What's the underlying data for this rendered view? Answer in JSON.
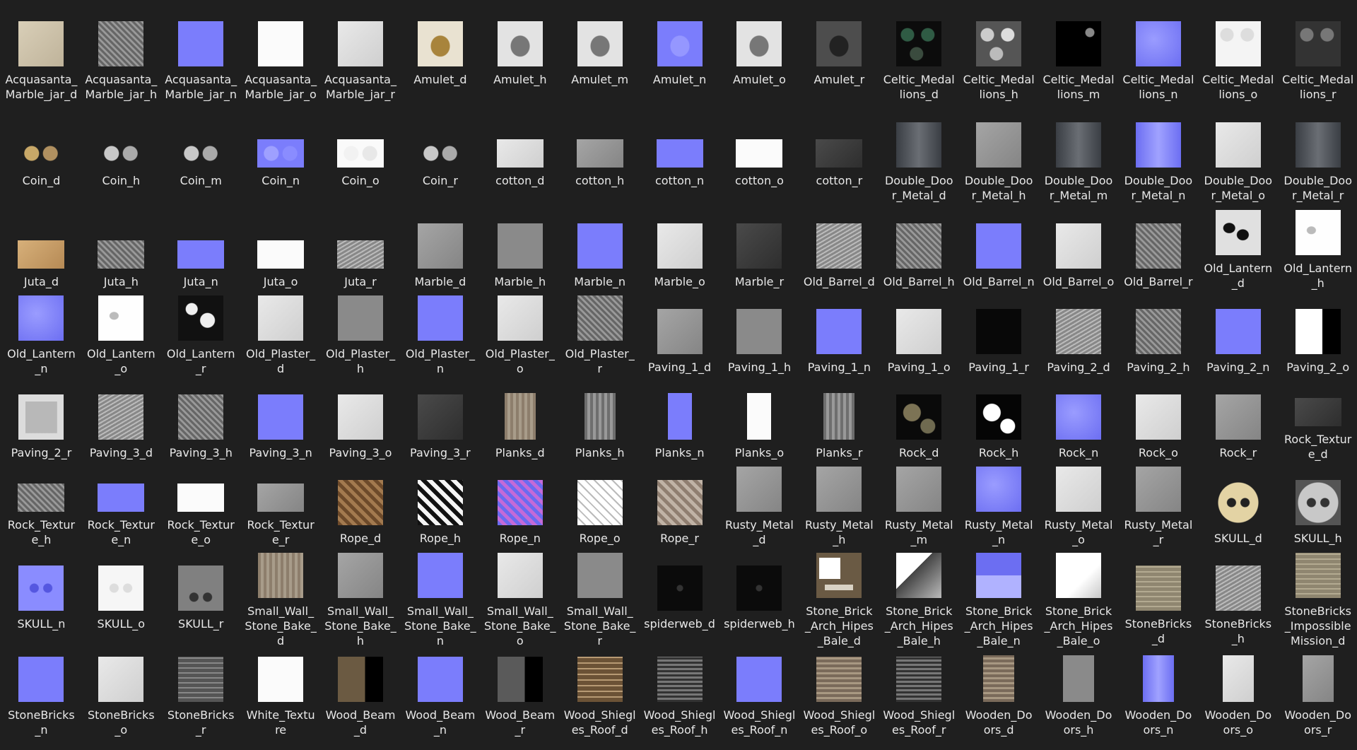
{
  "items": [
    {
      "label": "Acquasanta_Marble_jar_d",
      "tex": "t-sand"
    },
    {
      "label": "Acquasanta_Marble_jar_h",
      "tex": "t-noise"
    },
    {
      "label": "Acquasanta_Marble_jar_n",
      "tex": "t-normal"
    },
    {
      "label": "Acquasanta_Marble_jar_o",
      "tex": "t-white"
    },
    {
      "label": "Acquasanta_Marble_jar_r",
      "tex": "t-light"
    },
    {
      "label": "Amulet_d",
      "tex": "t-amulet"
    },
    {
      "label": "Amulet_h",
      "tex": "t-amulet-g"
    },
    {
      "label": "Amulet_m",
      "tex": "t-amulet-g"
    },
    {
      "label": "Amulet_n",
      "tex": "t-amulet-b"
    },
    {
      "label": "Amulet_o",
      "tex": "t-amulet-g"
    },
    {
      "label": "Amulet_r",
      "tex": "t-amulet-d"
    },
    {
      "label": "Celtic_Medallions_d",
      "tex": "t-medal"
    },
    {
      "label": "Celtic_Medallions_h",
      "tex": "t-medal-h"
    },
    {
      "label": "Celtic_Medallions_m",
      "tex": "t-medal-m"
    },
    {
      "label": "Celtic_Medallions_n",
      "tex": "t-normal2"
    },
    {
      "label": "Celtic_Medallions_o",
      "tex": "t-medal-w"
    },
    {
      "label": "Celtic_Medallions_r",
      "tex": "t-medal-r"
    },
    {
      "label": "Coin_d",
      "tex": "t-coin",
      "shape": "wide"
    },
    {
      "label": "Coin_h",
      "tex": "t-coin-g",
      "shape": "wide"
    },
    {
      "label": "Coin_m",
      "tex": "t-coin-g",
      "shape": "wide"
    },
    {
      "label": "Coin_n",
      "tex": "t-coin-b",
      "shape": "wide"
    },
    {
      "label": "Coin_o",
      "tex": "t-coin-w",
      "shape": "wide"
    },
    {
      "label": "Coin_r",
      "tex": "t-coin-g",
      "shape": "wide"
    },
    {
      "label": "cotton_d",
      "tex": "t-light",
      "shape": "wide"
    },
    {
      "label": "cotton_h",
      "tex": "t-mid",
      "shape": "wide"
    },
    {
      "label": "cotton_n",
      "tex": "t-normal",
      "shape": "wide"
    },
    {
      "label": "cotton_o",
      "tex": "t-white",
      "shape": "wide"
    },
    {
      "label": "cotton_r",
      "tex": "t-dark",
      "shape": "wide"
    },
    {
      "label": "Double_Door_Metal_d",
      "tex": "t-door"
    },
    {
      "label": "Double_Door_Metal_h",
      "tex": "t-mid"
    },
    {
      "label": "Double_Door_Metal_m",
      "tex": "t-door"
    },
    {
      "label": "Double_Door_Metal_n",
      "tex": "t-door-b"
    },
    {
      "label": "Double_Door_Metal_o",
      "tex": "t-light"
    },
    {
      "label": "Double_Door_Metal_r",
      "tex": "t-door"
    },
    {
      "label": "Juta_d",
      "tex": "t-tan",
      "shape": "wide"
    },
    {
      "label": "Juta_h",
      "tex": "t-noise",
      "shape": "wide"
    },
    {
      "label": "Juta_n",
      "tex": "t-normal",
      "shape": "wide"
    },
    {
      "label": "Juta_o",
      "tex": "t-white",
      "shape": "wide"
    },
    {
      "label": "Juta_r",
      "tex": "t-noise2",
      "shape": "wide"
    },
    {
      "label": "Marble_d",
      "tex": "t-mid"
    },
    {
      "label": "Marble_h",
      "tex": "t-gray"
    },
    {
      "label": "Marble_n",
      "tex": "t-normal"
    },
    {
      "label": "Marble_o",
      "tex": "t-light"
    },
    {
      "label": "Marble_r",
      "tex": "t-dark"
    },
    {
      "label": "Old_Barrel_d",
      "tex": "t-noise2"
    },
    {
      "label": "Old_Barrel_h",
      "tex": "t-noise"
    },
    {
      "label": "Old_Barrel_n",
      "tex": "t-normal"
    },
    {
      "label": "Old_Barrel_o",
      "tex": "t-light"
    },
    {
      "label": "Old_Barrel_r",
      "tex": "t-noise"
    },
    {
      "label": "Old_Lantern_d",
      "tex": "t-lantern"
    },
    {
      "label": "Old_Lantern_h",
      "tex": "t-lantern-w"
    },
    {
      "label": "Old_Lantern_n",
      "tex": "t-normal2"
    },
    {
      "label": "Old_Lantern_o",
      "tex": "t-lantern-w"
    },
    {
      "label": "Old_Lantern_r",
      "tex": "t-splotch-d"
    },
    {
      "label": "Old_Plaster_d",
      "tex": "t-light"
    },
    {
      "label": "Old_Plaster_h",
      "tex": "t-gray"
    },
    {
      "label": "Old_Plaster_n",
      "tex": "t-normal"
    },
    {
      "label": "Old_Plaster_o",
      "tex": "t-light"
    },
    {
      "label": "Old_Plaster_r",
      "tex": "t-noise"
    },
    {
      "label": "Paving_1_d",
      "tex": "t-mid"
    },
    {
      "label": "Paving_1_h",
      "tex": "t-gray"
    },
    {
      "label": "Paving_1_n",
      "tex": "t-normal"
    },
    {
      "label": "Paving_1_o",
      "tex": "t-light"
    },
    {
      "label": "Paving_1_r",
      "tex": "t-black"
    },
    {
      "label": "Paving_2_d",
      "tex": "t-noise2"
    },
    {
      "label": "Paving_2_h",
      "tex": "t-noise"
    },
    {
      "label": "Paving_2_n",
      "tex": "t-normal"
    },
    {
      "label": "Paving_2_o",
      "tex": "t-paving2o"
    },
    {
      "label": "Paving_2_r",
      "tex": "t-paving2r"
    },
    {
      "label": "Paving_3_d",
      "tex": "t-noise2"
    },
    {
      "label": "Paving_3_h",
      "tex": "t-noise"
    },
    {
      "label": "Paving_3_n",
      "tex": "t-normal"
    },
    {
      "label": "Paving_3_o",
      "tex": "t-light"
    },
    {
      "label": "Paving_3_r",
      "tex": "t-dark"
    },
    {
      "label": "Planks_d",
      "tex": "t-plank",
      "shape": "tall"
    },
    {
      "label": "Planks_h",
      "tex": "t-plank-g",
      "shape": "tall"
    },
    {
      "label": "Planks_n",
      "tex": "t-normal",
      "shape": "narrow"
    },
    {
      "label": "Planks_o",
      "tex": "t-white",
      "shape": "narrow"
    },
    {
      "label": "Planks_r",
      "tex": "t-plank-g",
      "shape": "tall"
    },
    {
      "label": "Rock_d",
      "tex": "t-rock-d"
    },
    {
      "label": "Rock_h",
      "tex": "t-rock-h"
    },
    {
      "label": "Rock_n",
      "tex": "t-normal2"
    },
    {
      "label": "Rock_o",
      "tex": "t-light"
    },
    {
      "label": "Rock_r",
      "tex": "t-mid"
    },
    {
      "label": "Rock_Texture_d",
      "tex": "t-dark",
      "shape": "wide"
    },
    {
      "label": "Rock_Texture_h",
      "tex": "t-noise",
      "shape": "wide"
    },
    {
      "label": "Rock_Texture_n",
      "tex": "t-normal",
      "shape": "wide"
    },
    {
      "label": "Rock_Texture_o",
      "tex": "t-white",
      "shape": "wide"
    },
    {
      "label": "Rock_Texture_r",
      "tex": "t-mid",
      "shape": "wide"
    },
    {
      "label": "Rope_d",
      "tex": "t-stripe-brown"
    },
    {
      "label": "Rope_h",
      "tex": "t-stripe-bw"
    },
    {
      "label": "Rope_n",
      "tex": "t-stripe-blue"
    },
    {
      "label": "Rope_o",
      "tex": "t-stripe-wh"
    },
    {
      "label": "Rope_r",
      "tex": "t-stripe-gr"
    },
    {
      "label": "Rusty_Metal_d",
      "tex": "t-mid"
    },
    {
      "label": "Rusty_Metal_h",
      "tex": "t-mid"
    },
    {
      "label": "Rusty_Metal_m",
      "tex": "t-mid"
    },
    {
      "label": "Rusty_Metal_n",
      "tex": "t-normal2"
    },
    {
      "label": "Rusty_Metal_o",
      "tex": "t-light"
    },
    {
      "label": "Rusty_Metal_r",
      "tex": "t-mid"
    },
    {
      "label": "SKULL_d",
      "tex": "t-skull"
    },
    {
      "label": "SKULL_h",
      "tex": "t-skull-g"
    },
    {
      "label": "SKULL_n",
      "tex": "t-skull-b"
    },
    {
      "label": "SKULL_o",
      "tex": "t-skull-w"
    },
    {
      "label": "SKULL_r",
      "tex": "t-skull-r"
    },
    {
      "label": "Small_Wall_Stone_Bake_d",
      "tex": "t-plank"
    },
    {
      "label": "Small_Wall_Stone_Bake_h",
      "tex": "t-mid"
    },
    {
      "label": "Small_Wall_Stone_Bake_n",
      "tex": "t-normal"
    },
    {
      "label": "Small_Wall_Stone_Bake_o",
      "tex": "t-light"
    },
    {
      "label": "Small_Wall_Stone_Bake_r",
      "tex": "t-gray"
    },
    {
      "label": "spiderweb_d",
      "tex": "t-spider"
    },
    {
      "label": "spiderweb_h",
      "tex": "t-spider"
    },
    {
      "label": "Stone_Brick_Arch_Hipes_Bale_d",
      "tex": "t-arch-d"
    },
    {
      "label": "Stone_Brick_Arch_Hipes_Bale_h",
      "tex": "t-arch-h"
    },
    {
      "label": "Stone_Brick_Arch_Hipes_Bale_n",
      "tex": "t-arch-n"
    },
    {
      "label": "Stone_Brick_Arch_Hipes_Bale_o",
      "tex": "t-arch-o"
    },
    {
      "label": "StoneBricks_d",
      "tex": "t-brick"
    },
    {
      "label": "StoneBricks_h",
      "tex": "t-noise2"
    },
    {
      "label": "StoneBricks_ImpossibleMission_d",
      "tex": "t-brick"
    },
    {
      "label": "StoneBricks_n",
      "tex": "t-normal"
    },
    {
      "label": "StoneBricks_o",
      "tex": "t-light"
    },
    {
      "label": "StoneBricks_r",
      "tex": "t-brick-g"
    },
    {
      "label": "White_Texture",
      "tex": "t-white"
    },
    {
      "label": "Wood_Beam_d",
      "tex": "t-split"
    },
    {
      "label": "Wood_Beam_n",
      "tex": "t-normal"
    },
    {
      "label": "Wood_Beam_r",
      "tex": "t-split-g"
    },
    {
      "label": "Wood_Shiegles_Roof_d",
      "tex": "t-roof"
    },
    {
      "label": "Wood_Shiegles_Roof_h",
      "tex": "t-wood-d"
    },
    {
      "label": "Wood_Shiegles_Roof_n",
      "tex": "t-normal"
    },
    {
      "label": "Wood_Shiegles_Roof_o",
      "tex": "t-wood"
    },
    {
      "label": "Wood_Shiegles_Roof_r",
      "tex": "t-wood-d"
    },
    {
      "label": "Wooden_Doors_d",
      "tex": "t-wood",
      "shape": "tall"
    },
    {
      "label": "Wooden_Doors_h",
      "tex": "t-gray",
      "shape": "tall"
    },
    {
      "label": "Wooden_Doors_n",
      "tex": "t-door-b",
      "shape": "tall"
    },
    {
      "label": "Wooden_Doors_o",
      "tex": "t-light",
      "shape": "tall"
    },
    {
      "label": "Wooden_Doors_r",
      "tex": "t-mid",
      "shape": "tall"
    }
  ]
}
